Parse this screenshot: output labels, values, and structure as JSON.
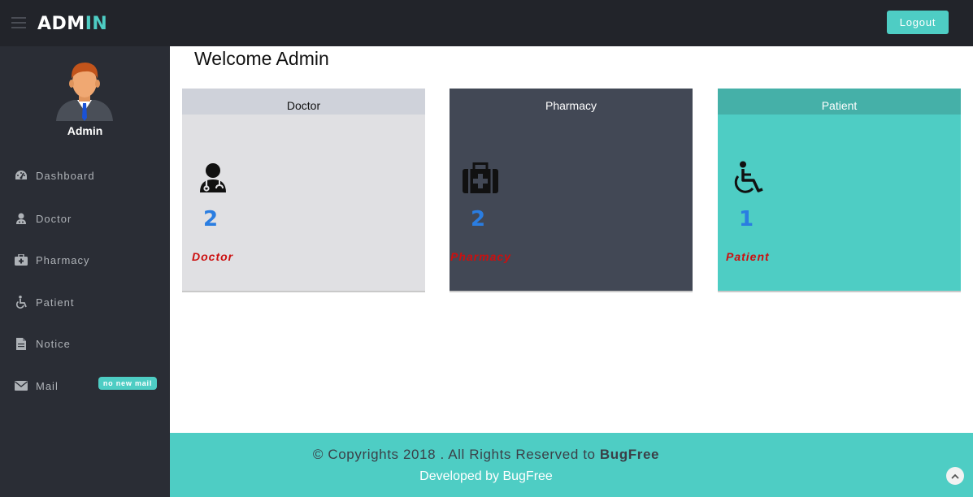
{
  "header": {
    "logo_part1": "ADM",
    "logo_part2": "IN",
    "logout_label": "Logout",
    "accent_color": "#4ecdc4"
  },
  "sidebar": {
    "profile_name": "Admin",
    "items": [
      {
        "label": "Dashboard",
        "icon": "dashboard-icon"
      },
      {
        "label": "Doctor",
        "icon": "user-md-icon"
      },
      {
        "label": "Pharmacy",
        "icon": "medkit-icon"
      },
      {
        "label": "Patient",
        "icon": "wheelchair-icon"
      },
      {
        "label": "Notice",
        "icon": "file-icon"
      },
      {
        "label": "Mail",
        "icon": "envelope-icon"
      }
    ],
    "mail_badge": "no new mail"
  },
  "main": {
    "welcome": "Welcome Admin",
    "cards": [
      {
        "title": "Doctor",
        "count": "2",
        "label": "Doctor",
        "icon": "user-md-icon"
      },
      {
        "title": "Pharmacy",
        "count": "2",
        "label": "Pharmacy",
        "icon": "medkit-icon"
      },
      {
        "title": "Patient",
        "count": "1",
        "label": "Patient",
        "icon": "wheelchair-icon"
      }
    ]
  },
  "footer": {
    "copyright_prefix": "© Copyrights 2018 . All Rights Reserved to ",
    "copyright_brand": "BugFree",
    "developed": "Developed by BugFree"
  }
}
